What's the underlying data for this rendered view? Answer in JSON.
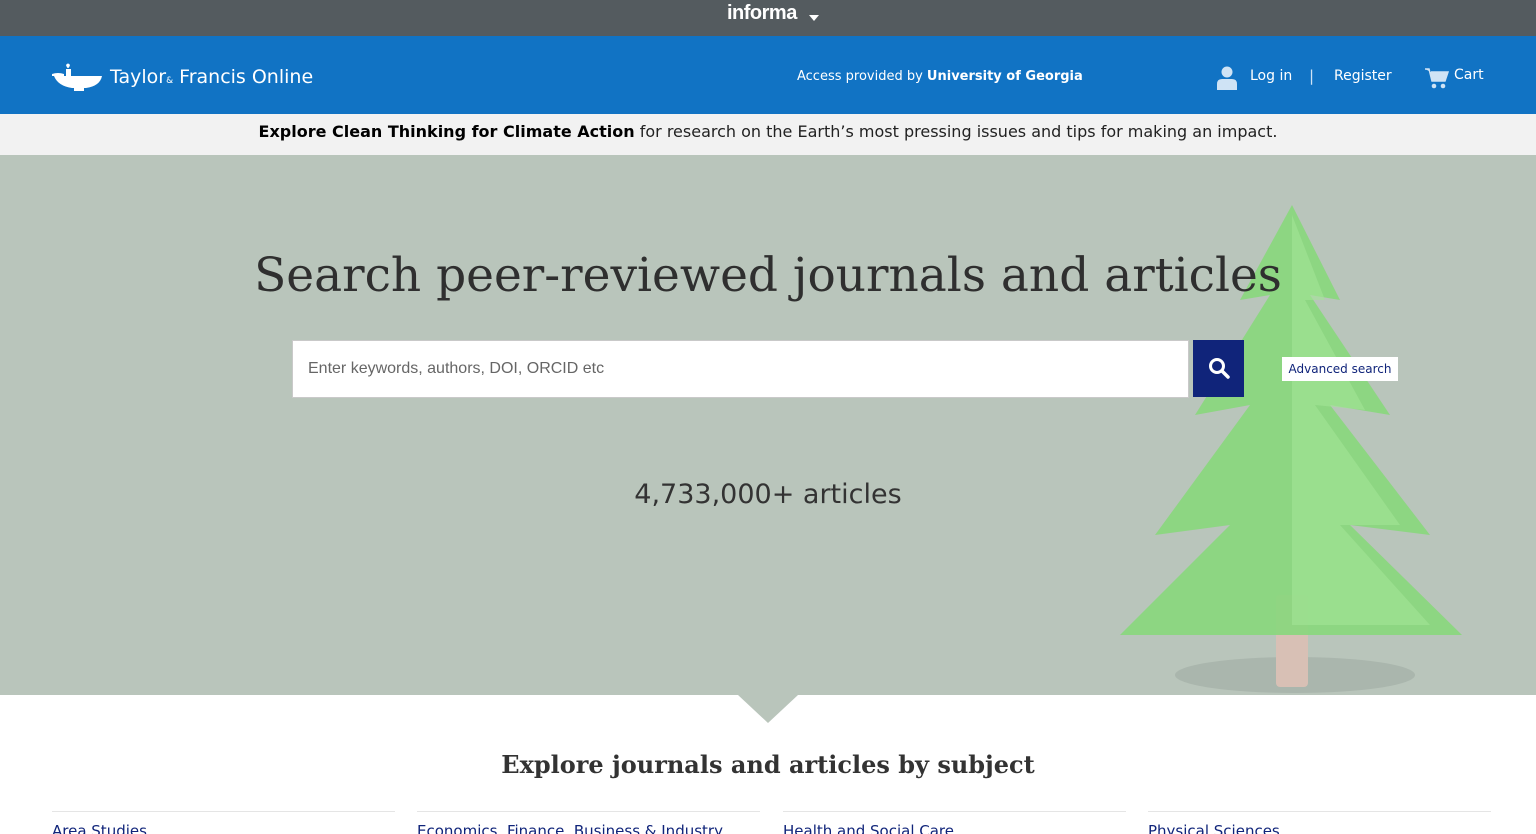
{
  "informa": {
    "logo": "informa"
  },
  "header": {
    "logo_main": "Taylor",
    "logo_amp": "&",
    "logo_rest": " Francis Online",
    "access_prefix": "Access provided by ",
    "access_institution": "University of Georgia",
    "login": "Log in",
    "separator": "|",
    "register": "Register",
    "cart": "Cart"
  },
  "promo": {
    "bold": "Explore Clean Thinking for Climate Action",
    "rest": " for research on the Earth’s most pressing issues and tips for making an impact."
  },
  "hero": {
    "title": "Search peer-reviewed journals and articles",
    "search_placeholder": "Enter keywords, authors, DOI, ORCID etc",
    "advanced_search": "Advanced search",
    "article_count": "4,733,000+ articles"
  },
  "explore": {
    "title": "Explore journals and articles by subject",
    "subjects": [
      "Area Studies",
      "Economics, Finance, Business & Industry",
      "Health and Social Care",
      "Physical Sciences"
    ]
  },
  "colors": {
    "header_blue": "#1173c4",
    "informa_gray": "#545b5f",
    "navy": "#10247a",
    "hero_bg": "#b9c5bb"
  }
}
